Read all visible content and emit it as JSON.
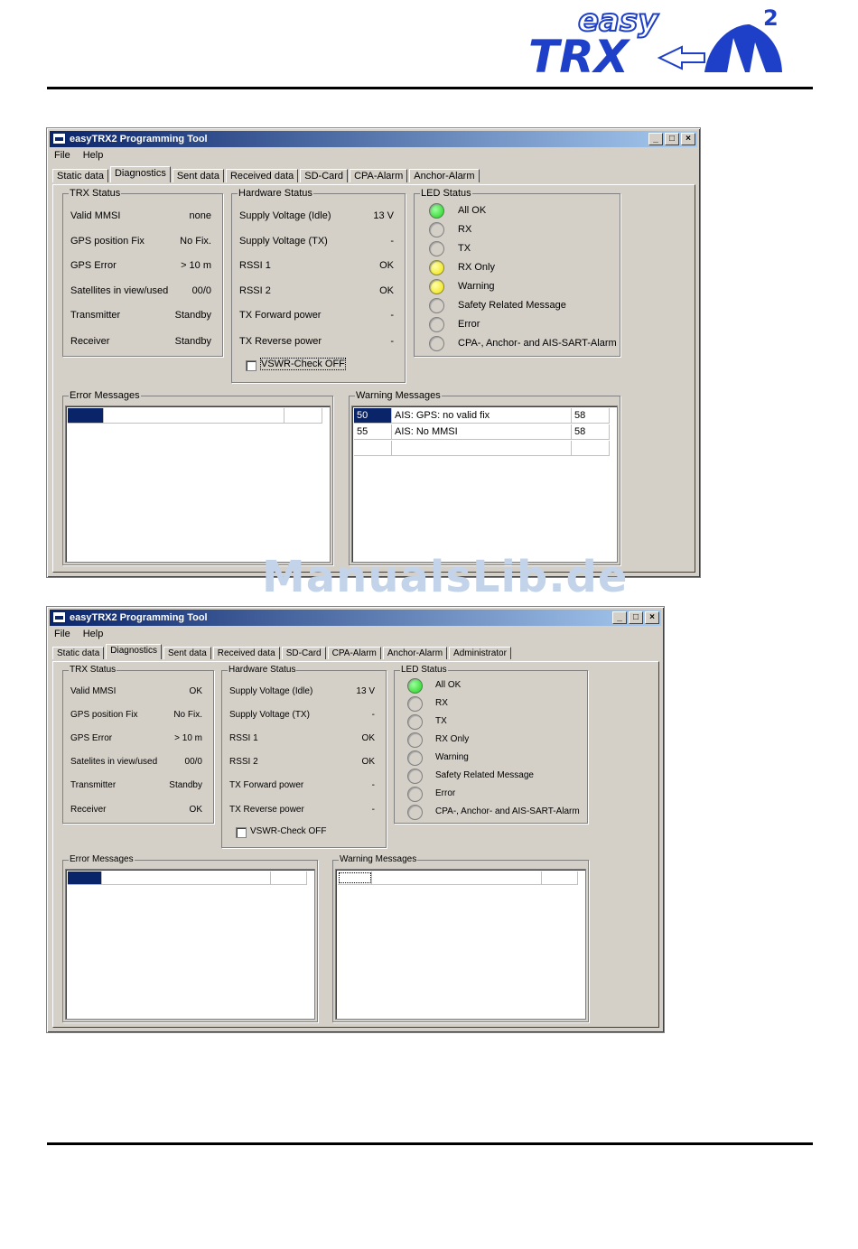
{
  "logo": {
    "easy": "easy",
    "trx": "TRX",
    "superscript": "2"
  },
  "watermark": "ManualsLib.de",
  "window1": {
    "title": "easyTRX2 Programming Tool",
    "menu": [
      "File",
      "Help"
    ],
    "tabs": [
      "Static data",
      "Diagnostics",
      "Sent data",
      "Received data",
      "SD-Card",
      "CPA-Alarm",
      "Anchor-Alarm"
    ],
    "active_tab": "Diagnostics",
    "trx_status": {
      "title": "TRX Status",
      "rows": [
        {
          "label": "Valid MMSI",
          "value": "none"
        },
        {
          "label": "GPS position Fix",
          "value": "No Fix."
        },
        {
          "label": "GPS Error",
          "value": "> 10 m"
        },
        {
          "label": "Satellites in view/used",
          "value": "00/0"
        },
        {
          "label": "Transmitter",
          "value": "Standby"
        },
        {
          "label": "Receiver",
          "value": "Standby"
        }
      ]
    },
    "hardware_status": {
      "title": "Hardware Status",
      "rows": [
        {
          "label": "Supply Voltage (Idle)",
          "value": "13 V"
        },
        {
          "label": "Supply Voltage (TX)",
          "value": "-"
        },
        {
          "label": "RSSI 1",
          "value": "OK"
        },
        {
          "label": "RSSI 2",
          "value": "OK"
        },
        {
          "label": "TX Forward power",
          "value": "-"
        },
        {
          "label": "TX Reverse power",
          "value": "-"
        }
      ],
      "vswr_check": "VSWR-Check  OFF"
    },
    "led_status": {
      "title": "LED Status",
      "items": [
        {
          "label": "All OK",
          "color": "green"
        },
        {
          "label": "RX",
          "color": "off"
        },
        {
          "label": "TX",
          "color": "off"
        },
        {
          "label": "RX Only",
          "color": "yellow"
        },
        {
          "label": "Warning",
          "color": "yellow"
        },
        {
          "label": "Safety Related Message",
          "color": "off"
        },
        {
          "label": "Error",
          "color": "off"
        },
        {
          "label": "CPA-, Anchor- and  AIS-SART-Alarm",
          "color": "off"
        }
      ]
    },
    "error_messages": {
      "title": "Error Messages"
    },
    "warning_messages": {
      "title": "Warning Messages",
      "rows": [
        {
          "code": "50",
          "text": "AIS: GPS: no valid fix",
          "num": "58"
        },
        {
          "code": "55",
          "text": "AIS: No MMSI",
          "num": "58"
        }
      ]
    }
  },
  "window2": {
    "title": "easyTRX2 Programming Tool",
    "menu": [
      "File",
      "Help"
    ],
    "tabs": [
      "Static data",
      "Diagnostics",
      "Sent data",
      "Received data",
      "SD-Card",
      "CPA-Alarm",
      "Anchor-Alarm",
      "Administrator"
    ],
    "active_tab": "Diagnostics",
    "trx_status": {
      "title": "TRX Status",
      "rows": [
        {
          "label": "Valid MMSI",
          "value": "OK"
        },
        {
          "label": "GPS position Fix",
          "value": "No Fix."
        },
        {
          "label": "GPS Error",
          "value": "> 10 m"
        },
        {
          "label": "Satelites in view/used",
          "value": "00/0"
        },
        {
          "label": "Transmitter",
          "value": "Standby"
        },
        {
          "label": "Receiver",
          "value": "OK"
        }
      ]
    },
    "hardware_status": {
      "title": "Hardware Status",
      "rows": [
        {
          "label": "Supply Voltage (Idle)",
          "value": "13 V"
        },
        {
          "label": "Supply Voltage (TX)",
          "value": "-"
        },
        {
          "label": "RSSI 1",
          "value": "OK"
        },
        {
          "label": "RSSI 2",
          "value": "OK"
        },
        {
          "label": "TX Forward power",
          "value": "-"
        },
        {
          "label": "TX Reverse power",
          "value": "-"
        }
      ],
      "vswr_check": "VSWR-Check  OFF"
    },
    "led_status": {
      "title": "LED Status",
      "items": [
        {
          "label": "All OK",
          "color": "green"
        },
        {
          "label": "RX",
          "color": "off"
        },
        {
          "label": "TX",
          "color": "off"
        },
        {
          "label": "RX Only",
          "color": "off"
        },
        {
          "label": "Warning",
          "color": "off"
        },
        {
          "label": "Safety Related Message",
          "color": "off"
        },
        {
          "label": "Error",
          "color": "off"
        },
        {
          "label": "CPA-, Anchor- and AIS-SART-Alarm",
          "color": "off"
        }
      ]
    },
    "error_messages": {
      "title": "Error Messages"
    },
    "warning_messages": {
      "title": "Warning Messages"
    }
  }
}
